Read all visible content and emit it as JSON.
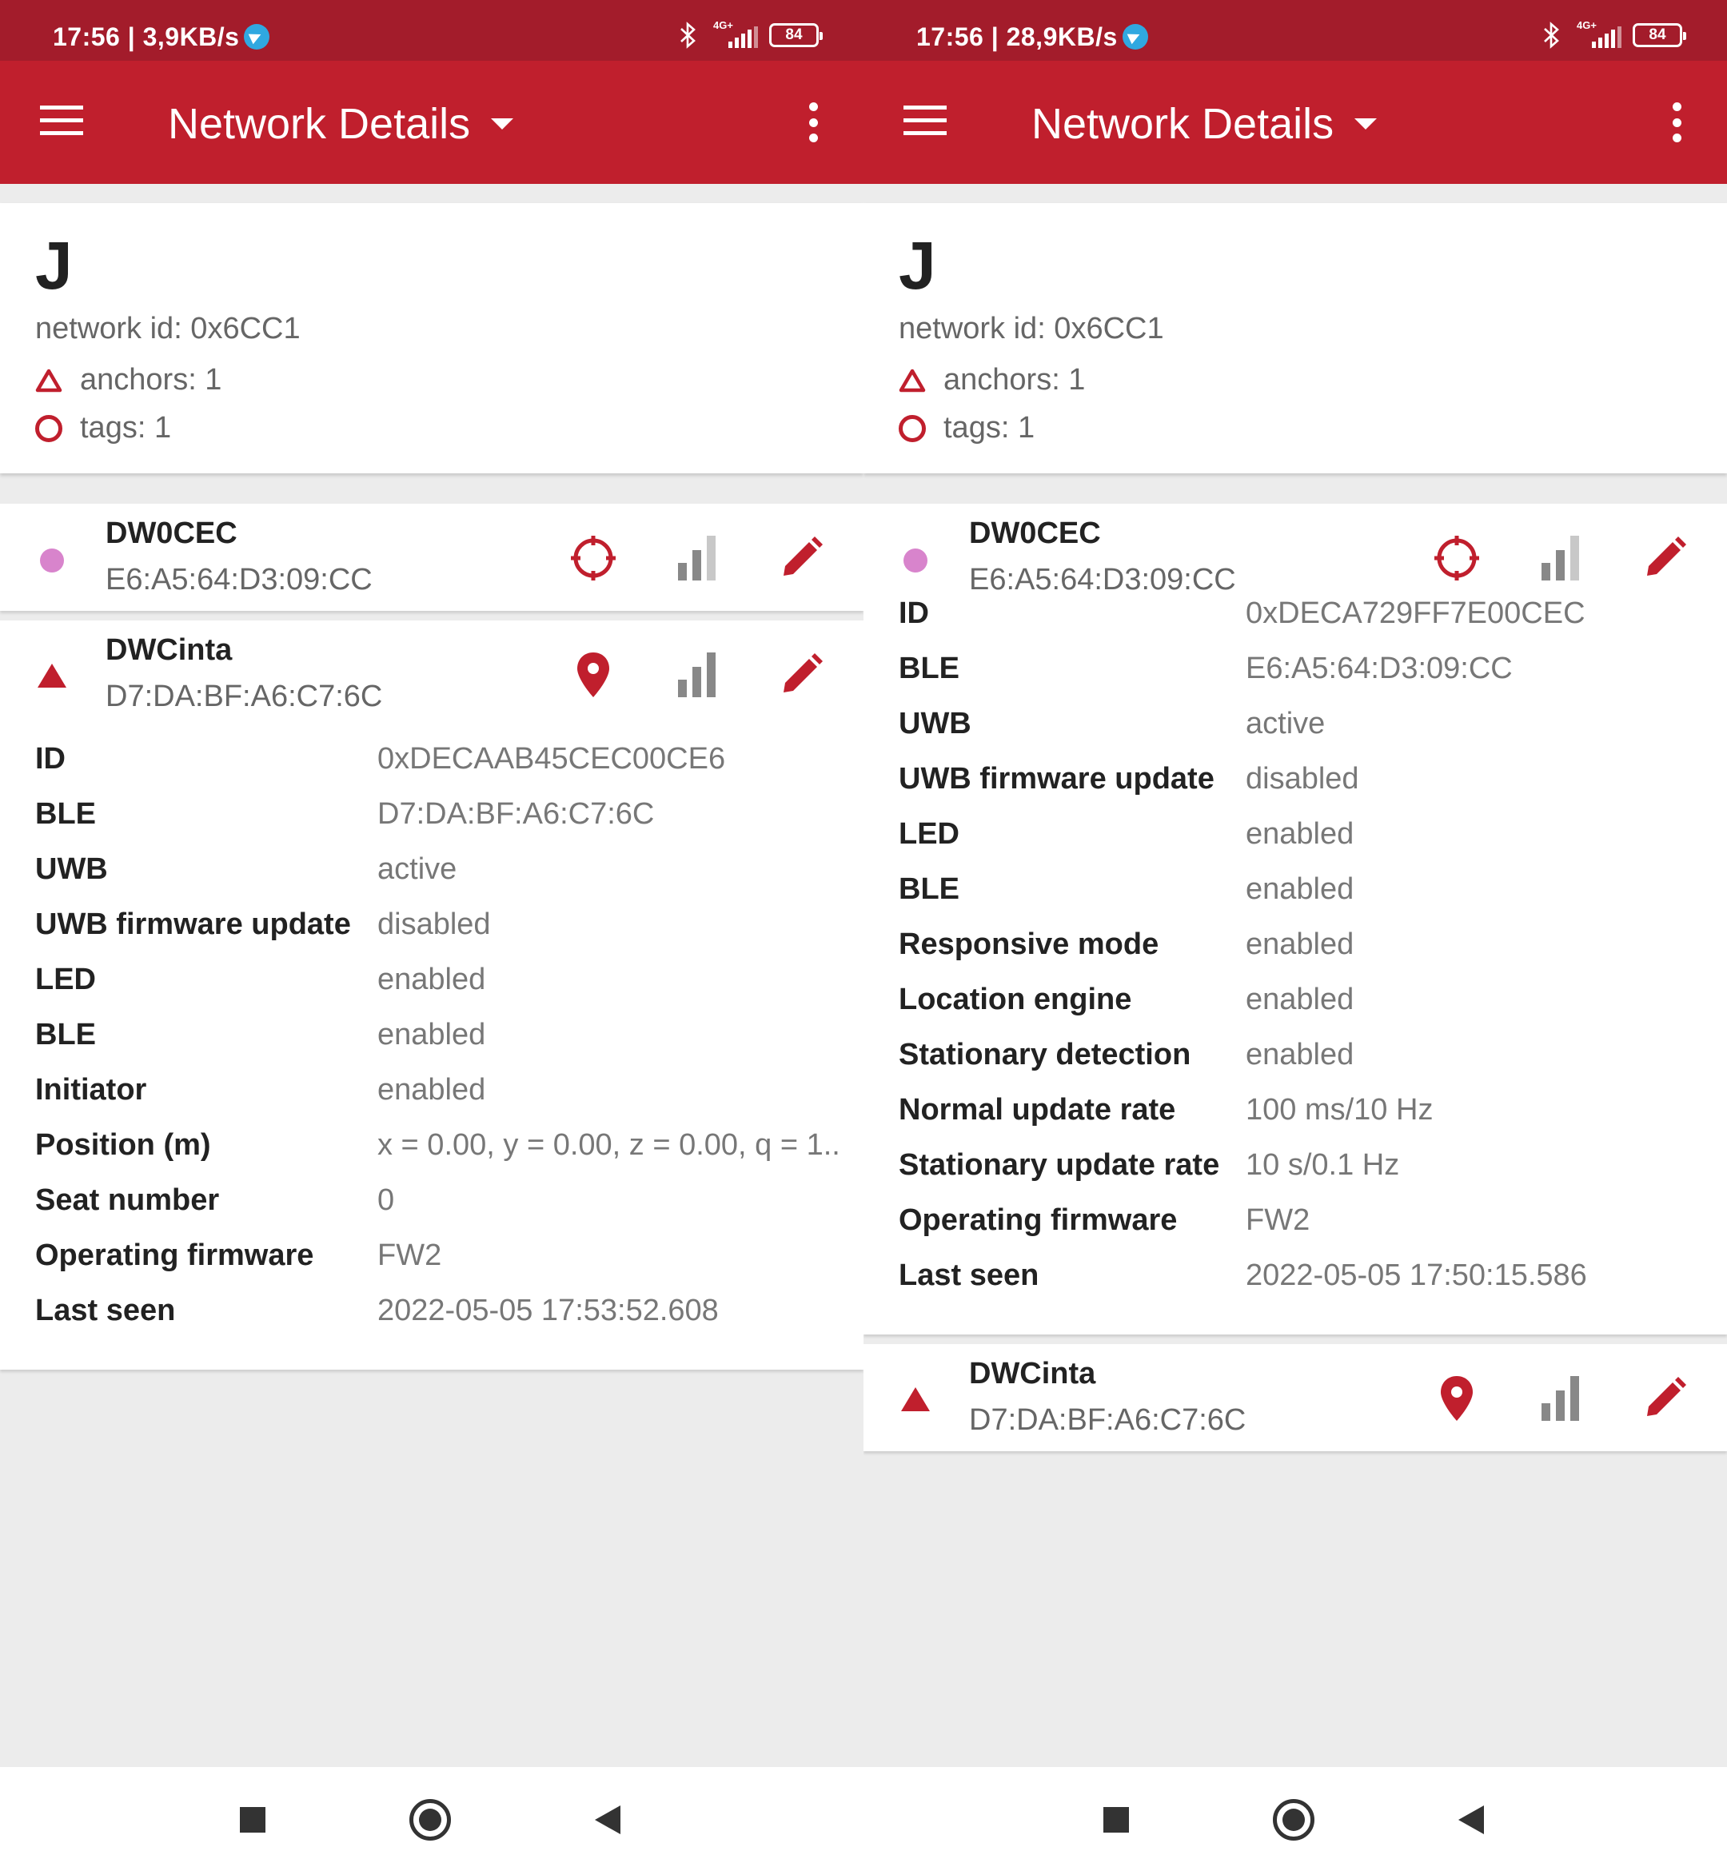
{
  "colors": {
    "primary": "#c01f2d",
    "status_bar": "#a31c2b",
    "tag_dot": "#d884cc",
    "signal_gray": "#888888"
  },
  "left": {
    "status": {
      "time_speed": "17:56 | 3,9KB/s",
      "network_type": "4G+",
      "battery": "84"
    },
    "appbar": {
      "title": "Network Details"
    },
    "network": {
      "name": "J",
      "id_line": "network id: 0x6CC1",
      "anchors": "anchors: 1",
      "tags": "tags: 1"
    },
    "nodes": [
      {
        "name": "DW0CEC",
        "mac": "E6:A5:64:D3:09:CC",
        "icon": "tag-dot",
        "locate_icon": "crosshair-icon"
      },
      {
        "name": "DWCinta",
        "mac": "D7:DA:BF:A6:C7:6C",
        "icon": "anchor-triangle",
        "locate_icon": "map-pin-icon",
        "details": [
          {
            "label": "ID",
            "value": "0xDECAAB45CEC00CE6"
          },
          {
            "label": "BLE",
            "value": "D7:DA:BF:A6:C7:6C"
          },
          {
            "label": "UWB",
            "value": "active"
          },
          {
            "label": "UWB firmware update",
            "value": "disabled"
          },
          {
            "label": "LED",
            "value": "enabled"
          },
          {
            "label": "BLE",
            "value": "enabled"
          },
          {
            "label": "Initiator",
            "value": "enabled"
          },
          {
            "label": "Position (m)",
            "value": "x = 0.00, y = 0.00, z = 0.00, q = 1.."
          },
          {
            "label": "Seat number",
            "value": "0"
          },
          {
            "label": "Operating firmware",
            "value": "FW2"
          },
          {
            "label": "Last seen",
            "value": "2022-05-05 17:53:52.608"
          }
        ]
      }
    ]
  },
  "right": {
    "status": {
      "time_speed": "17:56 | 28,9KB/s",
      "network_type": "4G+",
      "battery": "84"
    },
    "appbar": {
      "title": "Network Details"
    },
    "network": {
      "name": "J",
      "id_line": "network id: 0x6CC1",
      "anchors": "anchors: 1",
      "tags": "tags: 1"
    },
    "nodes": [
      {
        "name": "DW0CEC",
        "mac": "E6:A5:64:D3:09:CC",
        "icon": "tag-dot",
        "locate_icon": "crosshair-icon",
        "details": [
          {
            "label": "ID",
            "value": "0xDECA729FF7E00CEC"
          },
          {
            "label": "BLE",
            "value": "E6:A5:64:D3:09:CC"
          },
          {
            "label": "UWB",
            "value": "active"
          },
          {
            "label": "UWB firmware update",
            "value": "disabled"
          },
          {
            "label": "LED",
            "value": "enabled"
          },
          {
            "label": "BLE",
            "value": "enabled"
          },
          {
            "label": "Responsive mode",
            "value": "enabled"
          },
          {
            "label": "Location engine",
            "value": "enabled"
          },
          {
            "label": "Stationary detection",
            "value": "enabled"
          },
          {
            "label": "Normal update rate",
            "value": "100 ms/10 Hz"
          },
          {
            "label": "Stationary update rate",
            "value": "10 s/0.1 Hz"
          },
          {
            "label": "Operating firmware",
            "value": "FW2"
          },
          {
            "label": "Last seen",
            "value": "2022-05-05 17:50:15.586"
          }
        ]
      },
      {
        "name": "DWCinta",
        "mac": "D7:DA:BF:A6:C7:6C",
        "icon": "anchor-triangle",
        "locate_icon": "map-pin-icon"
      }
    ]
  }
}
